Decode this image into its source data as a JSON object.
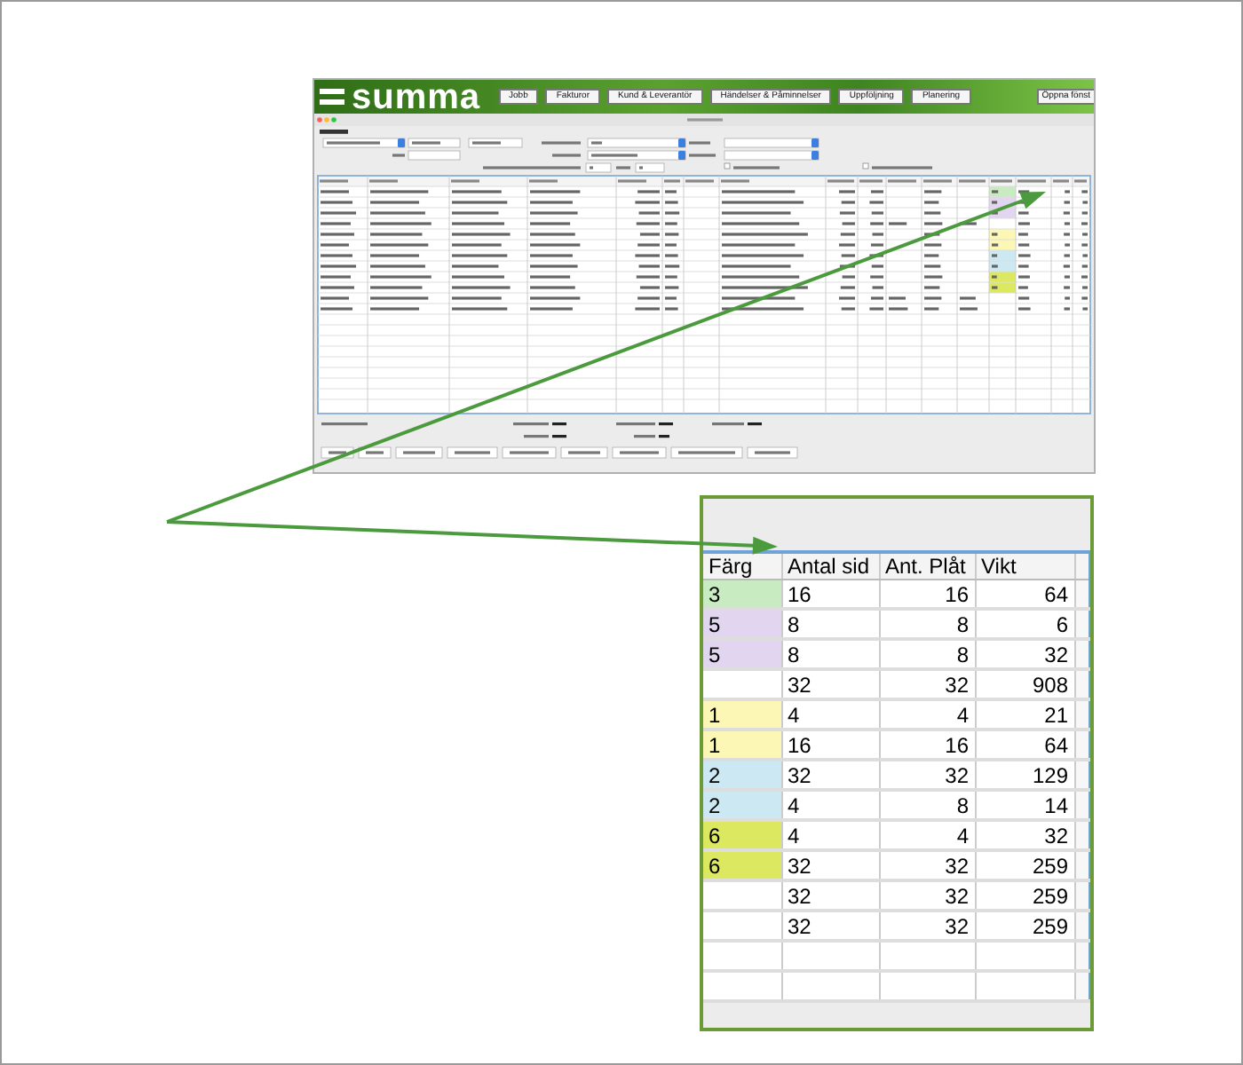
{
  "app": {
    "logo": "summa",
    "nav": [
      "Jobb",
      "Fakturor",
      "Kund & Leverantör",
      "Händelser & Påminnelser",
      "Uppföljning",
      "Planering"
    ],
    "nav_right": "Öppna fönst"
  },
  "inset": {
    "columns": [
      "Färg",
      "Antal sid",
      "Ant. Plåt",
      "Vikt"
    ],
    "rows": [
      {
        "farg": "3",
        "color": "#c9ebc1",
        "values": [
          "16",
          "16",
          "64"
        ]
      },
      {
        "farg": "5",
        "color": "#e2d5f0",
        "values": [
          "8",
          "8",
          "6"
        ]
      },
      {
        "farg": "5",
        "color": "#e2d5f0",
        "values": [
          "8",
          "8",
          "32"
        ]
      },
      {
        "values": [
          "32",
          "32",
          "908"
        ]
      },
      {
        "farg": "1",
        "color": "#fdf7b5",
        "values": [
          "4",
          "4",
          "21"
        ]
      },
      {
        "farg": "1",
        "color": "#fdf7b5",
        "values": [
          "16",
          "16",
          "64"
        ]
      },
      {
        "farg": "2",
        "color": "#cbe8f3",
        "values": [
          "32",
          "32",
          "129"
        ]
      },
      {
        "farg": "2",
        "color": "#cbe8f3",
        "values": [
          "4",
          "8",
          "14"
        ]
      },
      {
        "farg": "6",
        "color": "#dbe860",
        "values": [
          "4",
          "4",
          "32"
        ]
      },
      {
        "farg": "6",
        "color": "#dbe860",
        "values": [
          "32",
          "32",
          "259"
        ]
      },
      {
        "values": [
          "32",
          "32",
          "259"
        ]
      },
      {
        "values": [
          "32",
          "32",
          "259"
        ]
      }
    ]
  }
}
